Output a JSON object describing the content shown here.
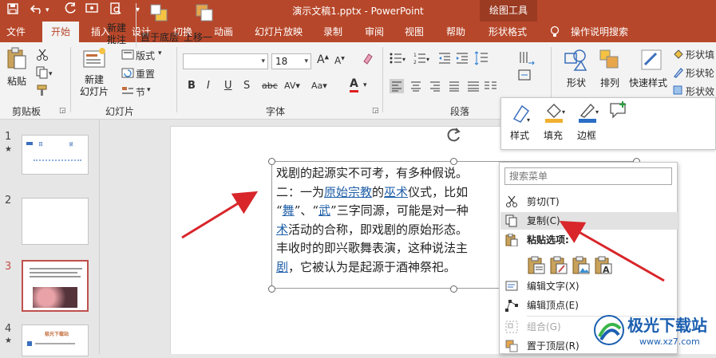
{
  "titlebar": {
    "title": "演示文稿1.pptx  -  PowerPoint",
    "context_tools": "绘图工具",
    "accent": "#b7472a"
  },
  "tabs": [
    {
      "label": "文件"
    },
    {
      "label": "开始",
      "active": true
    },
    {
      "label": "插入"
    },
    {
      "label": "设计"
    },
    {
      "label": "切换"
    },
    {
      "label": "动画"
    },
    {
      "label": "幻灯片放映"
    },
    {
      "label": "录制"
    },
    {
      "label": "审阅"
    },
    {
      "label": "视图"
    },
    {
      "label": "帮助"
    },
    {
      "label": "形状格式"
    },
    {
      "label": "操作说明搜索"
    }
  ],
  "ribbon": {
    "paste": "粘贴",
    "new_slide": "新建\n幻灯片",
    "layout": "版式",
    "reset": "重置",
    "section": "节",
    "font_name": "",
    "font_size": "18",
    "shape": "形状",
    "arrange": "排列",
    "quick_styles": "快速样式",
    "shape_fill": "形状填",
    "shape_outline": "形状轮",
    "shape_effects": "形状效",
    "groups": {
      "clipboard": "剪贴板",
      "slides": "幻灯片",
      "font": "字体",
      "paragraph": "段落"
    }
  },
  "thumbnails": [
    {
      "num": "1",
      "star": "★",
      "text_a": "目",
      "text_b": "录"
    },
    {
      "num": "2",
      "star": ""
    },
    {
      "num": "3",
      "star": "★",
      "selected": true
    },
    {
      "num": "4",
      "star": "★",
      "title": "极光下载站"
    }
  ],
  "slide_text": {
    "line1": "戏剧的起源实不可考，有多种假说。",
    "line2_a": "二：一为",
    "line2_link1": "原始宗教",
    "line2_b": "的",
    "line2_link2": "巫术",
    "line2_c": "仪式，比如",
    "line3_a": "“",
    "line3_link1": "舞",
    "line3_b": "”、“",
    "line3_link2": "武",
    "line3_c": "”三字同源，可能是对一种",
    "line4_link": "术",
    "line4_b": "活动的合称，即戏剧的原始形态。",
    "line5": "丰收时的即兴歌舞表演，这种说法主",
    "line6_link": "剧",
    "line6_b": "，它被认为是起源于酒神祭祀。"
  },
  "mini_toolbar": {
    "style": "样式",
    "fill": "填充",
    "border": "边框",
    "new_comment": "新建\n批注",
    "send_back": "置于底层",
    "bring_forward": "上移一"
  },
  "context_menu": {
    "search_placeholder": "搜索菜单",
    "items": [
      {
        "label": "剪切(T)",
        "icon": "scissors-icon"
      },
      {
        "label": "复制(C)",
        "icon": "copy-icon",
        "highlight": true
      },
      {
        "label": "粘贴选项:",
        "icon": "paste-icon",
        "bold": true
      },
      {
        "label": "编辑文字(X)",
        "icon": "edit-text-icon"
      },
      {
        "label": "编辑顶点(E)",
        "icon": "edit-points-icon"
      },
      {
        "label": "组合(G)",
        "icon": "group-icon",
        "disabled": true
      },
      {
        "label": "置于顶层(R)",
        "icon": "bring-to-front-icon"
      }
    ]
  },
  "watermark": {
    "text": "极光下载站",
    "url": "www.xz7.com"
  },
  "colors": {
    "arrow": "#d8262b",
    "link": "#1f5fa8"
  }
}
